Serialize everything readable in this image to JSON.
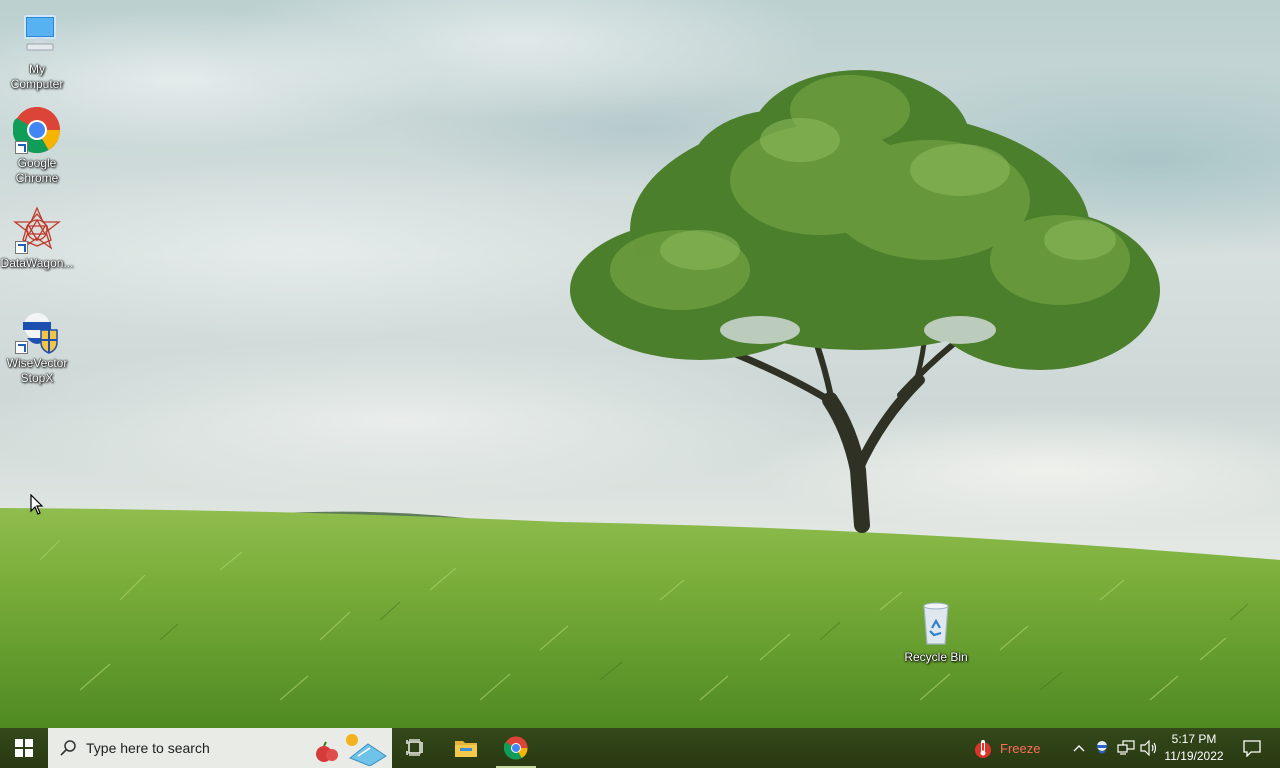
{
  "desktop": {
    "icons": [
      {
        "label": "My\nComputer",
        "icon": "monitor-icon"
      },
      {
        "label": "Google\nChrome",
        "icon": "chrome-icon"
      },
      {
        "label": "DataWagon...",
        "icon": "datawagon-icon"
      },
      {
        "label": "WiseVector\nStopX",
        "icon": "wisevector-icon"
      },
      {
        "label": "Recycle Bin",
        "icon": "recycle-bin-icon"
      }
    ]
  },
  "taskbar": {
    "search_placeholder": "Type here to search",
    "pinned": [
      "start-icon",
      "task-view-icon",
      "file-explorer-icon",
      "chrome-icon"
    ],
    "freeze_label": "Freeze",
    "freeze_color": "#ff6d5a",
    "tray_icons": [
      "chevron-up-icon",
      "wisevector-tray-icon",
      "network-icon",
      "volume-icon"
    ],
    "clock": {
      "time": "5:17 PM",
      "date": "11/19/2022"
    }
  }
}
